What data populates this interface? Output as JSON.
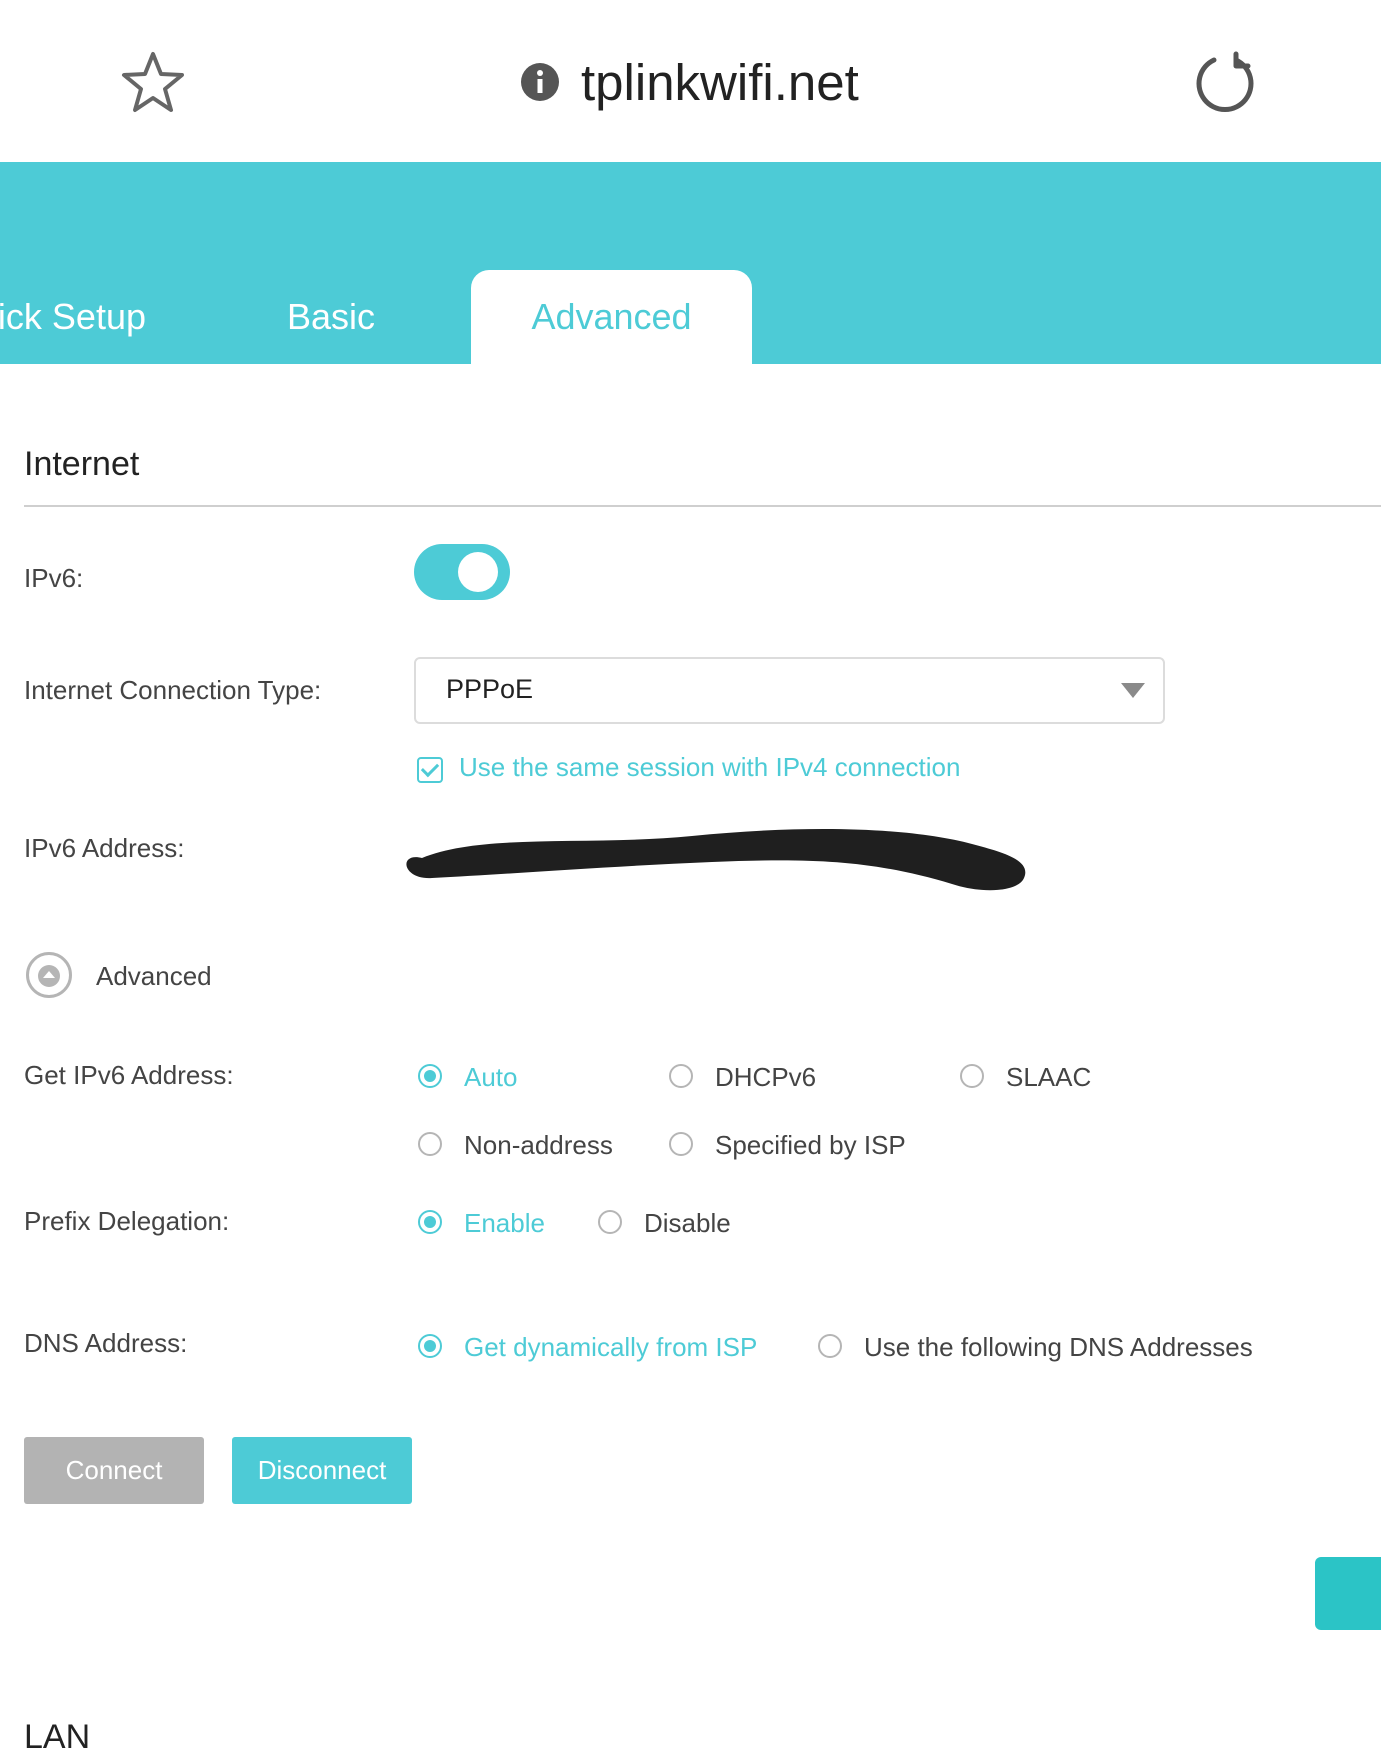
{
  "browser": {
    "url": "tplinkwifi.net",
    "bookmark_icon": "star-outline-icon",
    "site_info_icon": "info-circle-icon",
    "reload_icon": "reload-icon"
  },
  "tabs": [
    {
      "label": "ick Setup",
      "selected": false
    },
    {
      "label": "Basic",
      "selected": false
    },
    {
      "label": "Advanced",
      "selected": true
    }
  ],
  "section": {
    "title": "Internet",
    "ipv6": {
      "label": "IPv6:",
      "enabled": true
    },
    "connection_type": {
      "label": "Internet Connection Type:",
      "value": "PPPoE"
    },
    "same_session": {
      "label": "Use the same session with IPv4 connection",
      "checked": true
    },
    "ipv6_address": {
      "label": "IPv6 Address:",
      "value": "redacted"
    },
    "advanced_toggle": {
      "label": "Advanced"
    },
    "get_ipv6": {
      "label": "Get IPv6 Address:",
      "options": [
        "Auto",
        "DHCPv6",
        "SLAAC",
        "Non-address",
        "Specified by ISP"
      ],
      "selected": "Auto"
    },
    "prefix_delegation": {
      "label": "Prefix Delegation:",
      "options": [
        "Enable",
        "Disable"
      ],
      "selected": "Enable"
    },
    "dns": {
      "label": "DNS Address:",
      "options": [
        "Get dynamically from ISP",
        "Use the following DNS Addresses"
      ],
      "selected": "Get dynamically from ISP"
    },
    "buttons": {
      "connect": "Connect",
      "disconnect": "Disconnect"
    }
  },
  "next_section": {
    "title": "LAN"
  },
  "colors": {
    "accent": "#4dcbd6",
    "button_disabled": "#b3b3b3"
  }
}
